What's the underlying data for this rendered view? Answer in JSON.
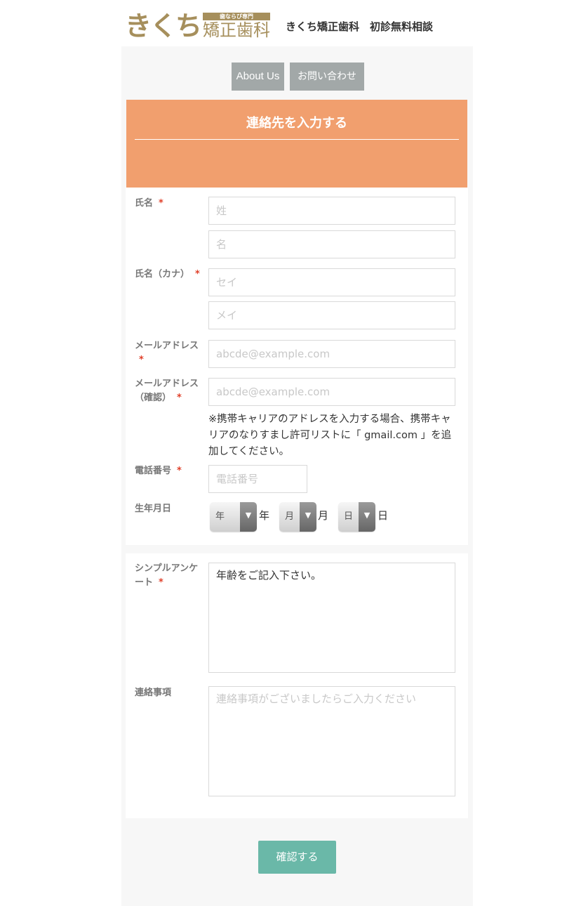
{
  "header": {
    "logo_main": "きくち",
    "logo_tag": "歯ならび専門",
    "logo_sub": "矯正歯科",
    "title": "きくち矯正歯科　初診無料相談"
  },
  "nav": {
    "about": "About Us",
    "contact": "お問い合わせ"
  },
  "banner": {
    "title": "連絡先を入力する"
  },
  "required_mark": "*",
  "form": {
    "name": {
      "label": "氏名",
      "last_placeholder": "姓",
      "first_placeholder": "名"
    },
    "kana": {
      "label": "氏名（カナ）",
      "last_placeholder": "セイ",
      "first_placeholder": "メイ"
    },
    "email": {
      "label": "メールアドレス",
      "placeholder": "abcde@example.com"
    },
    "email_confirm": {
      "label_line1": "メールアドレス",
      "label_line2": "（確認）",
      "placeholder": "abcde@example.com"
    },
    "email_note": "※携帯キャリアのアドレスを入力する場合、携帯キャリアのなりすまし許可リストに「 gmail.com 」を追加してください。",
    "phone": {
      "label": "電話番号",
      "placeholder": "電話番号"
    },
    "birthday": {
      "label": "生年月日",
      "year_value": "年",
      "year_unit": "年",
      "month_value": "月",
      "month_unit": "月",
      "day_value": "日",
      "day_unit": "日"
    },
    "survey": {
      "label_line1": "シンプルアンケ",
      "label_line2": "ート",
      "value": "年齢をご記入下さい。"
    },
    "contact_notes": {
      "label": "連絡事項",
      "placeholder": "連絡事項がございましたらご入力ください"
    }
  },
  "submit_label": "確認する",
  "colors": {
    "banner": "#f19f6e",
    "submit": "#6ab8a8",
    "nav_button": "#a2a8a8",
    "brand": "#a68f5c",
    "required": "#e0402a"
  }
}
